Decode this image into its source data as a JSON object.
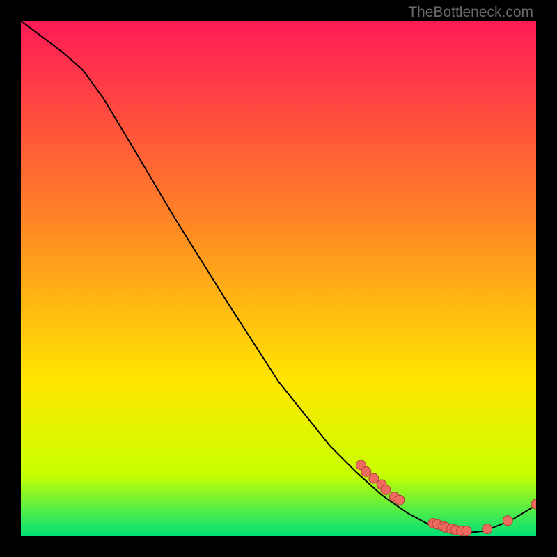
{
  "watermark": "TheBottleneck.com",
  "colors": {
    "grad_top": "#ff1a56",
    "grad_mid1": "#ff7a2a",
    "grad_mid2": "#ffe600",
    "grad_low": "#c8ff00",
    "grad_bottom": "#00e077",
    "line": "#000000",
    "dot_fill": "#ee6a5e",
    "dot_stroke": "#b23f38"
  },
  "chart_data": {
    "type": "line",
    "title": "",
    "xlabel": "",
    "ylabel": "",
    "xlim": [
      0,
      100
    ],
    "ylim": [
      0,
      100
    ],
    "curve": [
      {
        "x": 0,
        "y": 100
      },
      {
        "x": 4,
        "y": 97
      },
      {
        "x": 8,
        "y": 94
      },
      {
        "x": 12,
        "y": 90.5
      },
      {
        "x": 16,
        "y": 85
      },
      {
        "x": 22,
        "y": 75
      },
      {
        "x": 30,
        "y": 61.5
      },
      {
        "x": 40,
        "y": 45.5
      },
      {
        "x": 50,
        "y": 30
      },
      {
        "x": 60,
        "y": 17.5
      },
      {
        "x": 65,
        "y": 12.5
      },
      {
        "x": 70,
        "y": 8
      },
      {
        "x": 75,
        "y": 4.5
      },
      {
        "x": 80,
        "y": 1.8
      },
      {
        "x": 85,
        "y": 0.5
      },
      {
        "x": 90,
        "y": 1
      },
      {
        "x": 95,
        "y": 3
      },
      {
        "x": 100,
        "y": 6
      }
    ],
    "points": [
      {
        "x": 66,
        "y": 13.8
      },
      {
        "x": 67,
        "y": 12.5
      },
      {
        "x": 68.5,
        "y": 11.2
      },
      {
        "x": 70,
        "y": 10
      },
      {
        "x": 70.8,
        "y": 9
      },
      {
        "x": 72.5,
        "y": 7.6
      },
      {
        "x": 73.5,
        "y": 7
      },
      {
        "x": 80,
        "y": 2.5
      },
      {
        "x": 80.8,
        "y": 2.3
      },
      {
        "x": 82,
        "y": 1.9
      },
      {
        "x": 82.5,
        "y": 1.7
      },
      {
        "x": 83.6,
        "y": 1.4
      },
      {
        "x": 84.4,
        "y": 1.2
      },
      {
        "x": 85.5,
        "y": 1.0
      },
      {
        "x": 86.5,
        "y": 1.0
      },
      {
        "x": 90.5,
        "y": 1.4
      },
      {
        "x": 94.5,
        "y": 3.0
      },
      {
        "x": 100,
        "y": 6.2
      }
    ]
  }
}
